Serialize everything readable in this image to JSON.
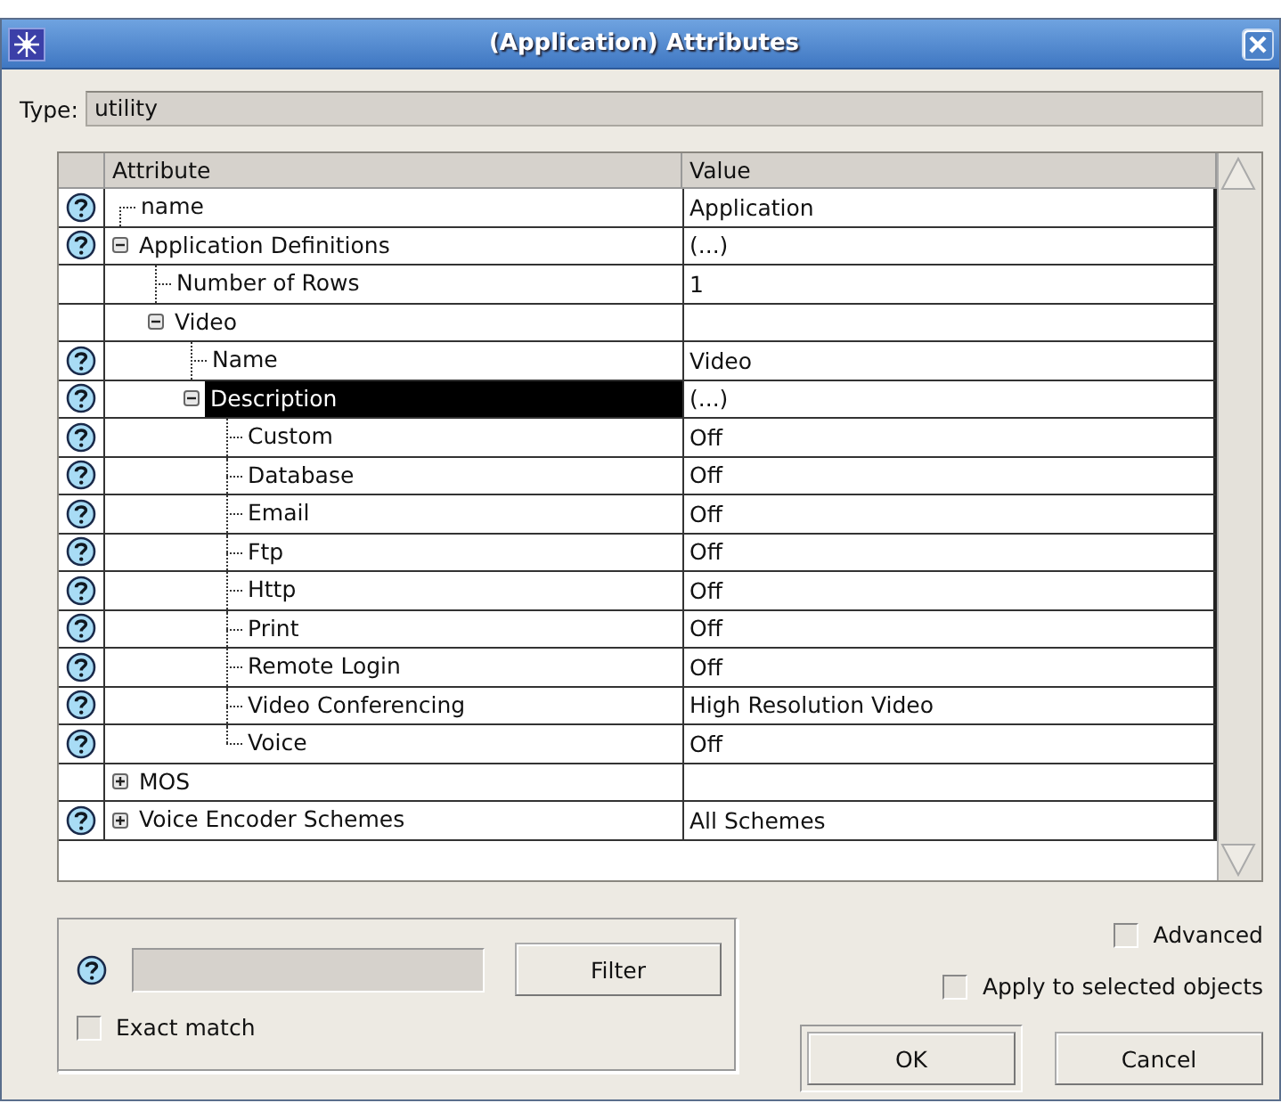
{
  "window": {
    "title": "(Application) Attributes"
  },
  "type_field": {
    "label": "Type:",
    "value": "utility"
  },
  "table": {
    "columns": [
      "Attribute",
      "Value"
    ],
    "rows": [
      {
        "name": "name",
        "value": "Application",
        "help": true,
        "selected": false
      },
      {
        "name": "Application Definitions",
        "value": "(...)",
        "help": true,
        "selected": false,
        "expanded": true,
        "children": [
          {
            "name": "Number of Rows",
            "value": "1",
            "help": false,
            "selected": false
          },
          {
            "name": "Video",
            "help": false,
            "selected": false,
            "expanded": true,
            "children": [
              {
                "name": "Name",
                "value": "Video",
                "help": true,
                "selected": false
              },
              {
                "name": "Description",
                "value": "(...)",
                "help": true,
                "selected": true,
                "expanded": true,
                "children": [
                  {
                    "name": "Custom",
                    "value": "Off",
                    "help": true,
                    "selected": false
                  },
                  {
                    "name": "Database",
                    "value": "Off",
                    "help": true,
                    "selected": false
                  },
                  {
                    "name": "Email",
                    "value": "Off",
                    "help": true,
                    "selected": false
                  },
                  {
                    "name": "Ftp",
                    "value": "Off",
                    "help": true,
                    "selected": false
                  },
                  {
                    "name": "Http",
                    "value": "Off",
                    "help": true,
                    "selected": false
                  },
                  {
                    "name": "Print",
                    "value": "Off",
                    "help": true,
                    "selected": false
                  },
                  {
                    "name": "Remote Login",
                    "value": "Off",
                    "help": true,
                    "selected": false
                  },
                  {
                    "name": "Video Conferencing",
                    "value": "High Resolution Video",
                    "help": true,
                    "selected": false
                  },
                  {
                    "name": "Voice",
                    "value": "Off",
                    "help": true,
                    "selected": false
                  }
                ]
              }
            ]
          }
        ]
      },
      {
        "name": "MOS",
        "help": false,
        "selected": false,
        "expanded": false
      },
      {
        "name": "Voice Encoder Schemes",
        "value": "All Schemes",
        "help": true,
        "selected": false,
        "expanded": false
      }
    ]
  },
  "filter": {
    "button": "Filter",
    "exact_match": {
      "label": "Exact match",
      "checked": false
    }
  },
  "options": [
    {
      "label": "Advanced",
      "checked": false
    },
    {
      "label": "Apply to selected objects",
      "checked": false
    }
  ],
  "buttons": [
    {
      "label": "OK",
      "default": true
    },
    {
      "label": "Cancel",
      "default": false
    }
  ]
}
